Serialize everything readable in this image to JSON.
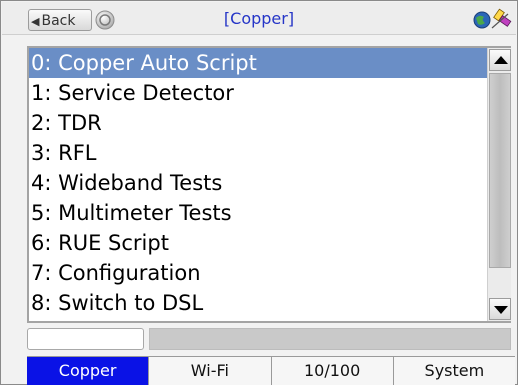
{
  "header": {
    "back_label": "Back",
    "title": "[Copper]",
    "icons": [
      "back-arrow-icon",
      "refresh-icon",
      "globe-icon",
      "satellite-icon"
    ]
  },
  "list": {
    "selected_index": 0,
    "items": [
      "0: Copper Auto Script",
      "1: Service Detector",
      "2: TDR",
      "3: RFL",
      "4: Wideband Tests",
      "5: Multimeter Tests",
      "6: RUE Script",
      "7: Configuration",
      "8: Switch to DSL"
    ]
  },
  "input": {
    "value": "",
    "placeholder": ""
  },
  "tabs": {
    "active_index": 0,
    "items": [
      "Copper",
      "Wi-Fi",
      "10/100",
      "System"
    ]
  },
  "colors": {
    "selection": "#6a8ec6",
    "active_tab": "#0a12e6",
    "title": "#2535c7"
  }
}
